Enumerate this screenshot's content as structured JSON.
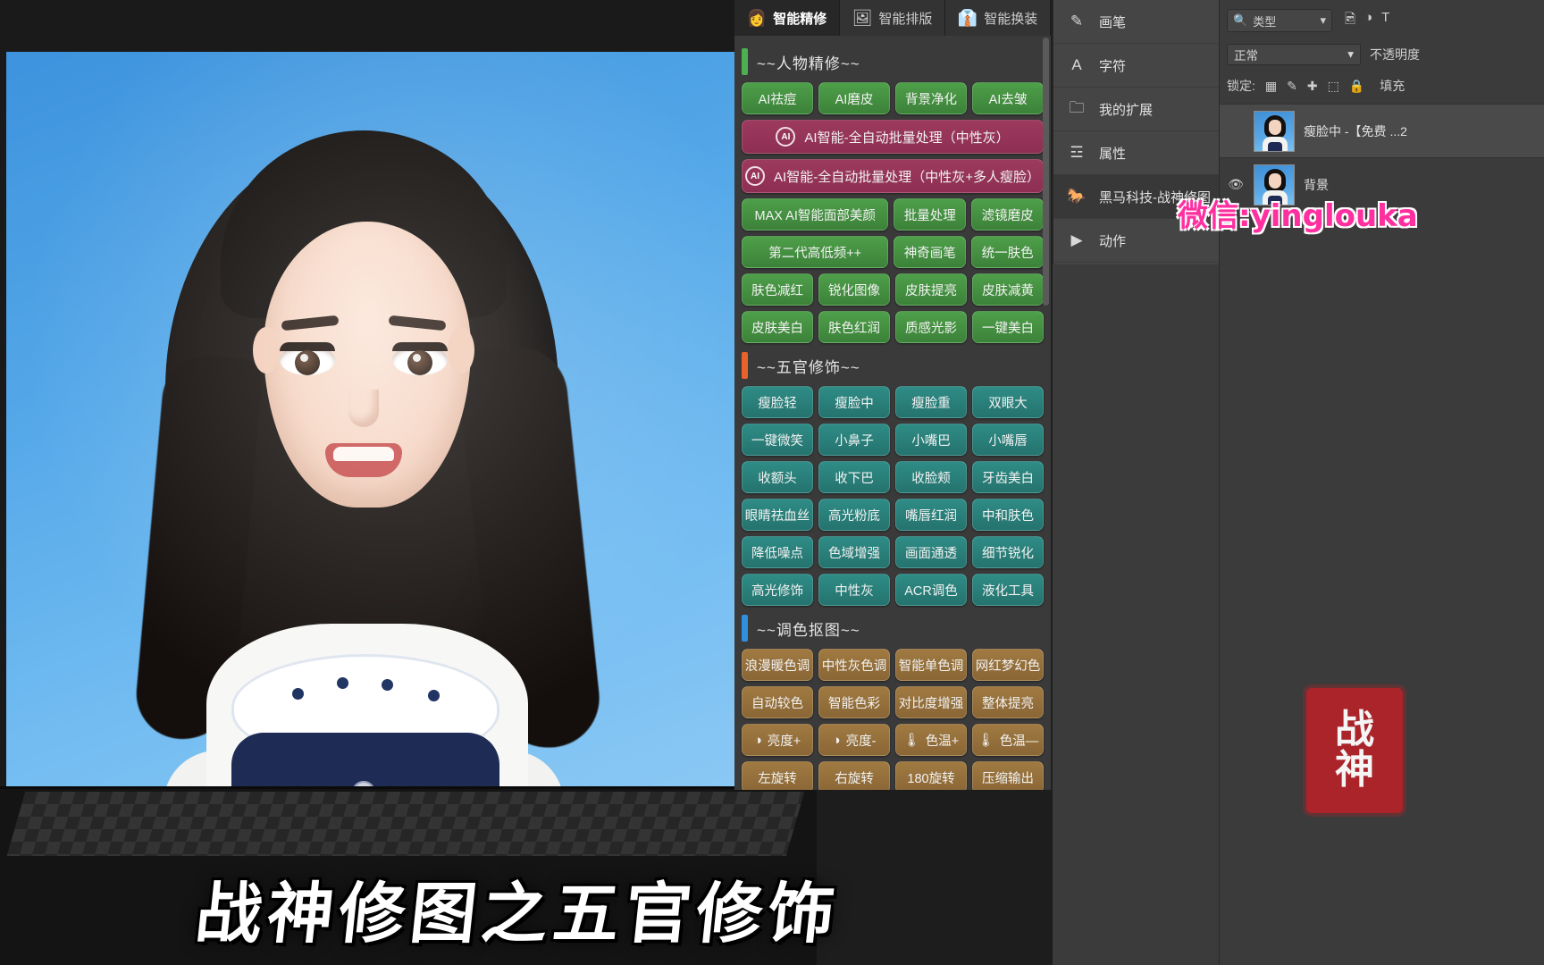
{
  "app": {
    "caption": "战神修图之五官修饰",
    "wechat_watermark": "微信:yinglouka",
    "stamp_line1": "战",
    "stamp_line2": "神"
  },
  "plugin": {
    "tabs": [
      {
        "label": "智能精修",
        "icon": "face-icon",
        "glyph": "👩",
        "active": true
      },
      {
        "label": "智能排版",
        "icon": "layout-icon",
        "glyph": "🖼",
        "active": false
      },
      {
        "label": "智能换装",
        "icon": "clothes-icon",
        "glyph": "👔",
        "active": false
      }
    ],
    "sections": [
      {
        "title": "~~人物精修~~",
        "bar_color": "#4caf50",
        "rows": [
          {
            "style": "green",
            "buttons": [
              {
                "label": "AI祛痘"
              },
              {
                "label": "AI磨皮"
              },
              {
                "label": "背景净化"
              },
              {
                "label": "AI去皱"
              }
            ]
          },
          {
            "style": "magenta",
            "buttons": [
              {
                "label": "AI智能-全自动批量处理（中性灰）",
                "icon": "ai-circle-icon",
                "full": true
              }
            ]
          },
          {
            "style": "magenta",
            "buttons": [
              {
                "label": "AI智能-全自动批量处理（中性灰+多人瘦脸）",
                "icon": "ai-circle-icon",
                "full": true
              }
            ]
          },
          {
            "style": "green",
            "buttons": [
              {
                "label": "MAX AI智能面部美颜",
                "wide": true
              },
              {
                "label": "批量处理"
              },
              {
                "label": "滤镜磨皮"
              }
            ]
          },
          {
            "style": "green",
            "buttons": [
              {
                "label": "第二代高低频++",
                "wide": true
              },
              {
                "label": "神奇画笔"
              },
              {
                "label": "统一肤色"
              }
            ]
          },
          {
            "style": "green",
            "buttons": [
              {
                "label": "肤色减红"
              },
              {
                "label": "锐化图像"
              },
              {
                "label": "皮肤提亮"
              },
              {
                "label": "皮肤减黄"
              }
            ]
          },
          {
            "style": "green",
            "buttons": [
              {
                "label": "皮肤美白"
              },
              {
                "label": "肤色红润"
              },
              {
                "label": "质感光影"
              },
              {
                "label": "一键美白"
              }
            ]
          }
        ]
      },
      {
        "title": "~~五官修饰~~",
        "bar_color": "#e8622a",
        "rows": [
          {
            "style": "teal",
            "buttons": [
              {
                "label": "瘦脸轻"
              },
              {
                "label": "瘦脸中"
              },
              {
                "label": "瘦脸重"
              },
              {
                "label": "双眼大"
              }
            ]
          },
          {
            "style": "teal",
            "buttons": [
              {
                "label": "一键微笑"
              },
              {
                "label": "小鼻子"
              },
              {
                "label": "小嘴巴"
              },
              {
                "label": "小嘴唇"
              }
            ]
          },
          {
            "style": "teal",
            "buttons": [
              {
                "label": "收额头"
              },
              {
                "label": "收下巴"
              },
              {
                "label": "收脸颊"
              },
              {
                "label": "牙齿美白"
              }
            ]
          },
          {
            "style": "teal",
            "buttons": [
              {
                "label": "眼睛祛血丝"
              },
              {
                "label": "高光粉底"
              },
              {
                "label": "嘴唇红润"
              },
              {
                "label": "中和肤色"
              }
            ]
          },
          {
            "style": "teal",
            "buttons": [
              {
                "label": "降低噪点"
              },
              {
                "label": "色域增强"
              },
              {
                "label": "画面通透"
              },
              {
                "label": "细节锐化"
              }
            ]
          },
          {
            "style": "teal",
            "buttons": [
              {
                "label": "高光修饰"
              },
              {
                "label": "中性灰"
              },
              {
                "label": "ACR调色"
              },
              {
                "label": "液化工具"
              }
            ]
          }
        ]
      },
      {
        "title": "~~调色抠图~~",
        "bar_color": "#2f8fe0",
        "rows": [
          {
            "style": "brown",
            "buttons": [
              {
                "label": "浪漫暖色调"
              },
              {
                "label": "中性灰色调"
              },
              {
                "label": "智能单色调"
              },
              {
                "label": "网红梦幻色"
              }
            ]
          },
          {
            "style": "brown",
            "buttons": [
              {
                "label": "自动较色"
              },
              {
                "label": "智能色彩"
              },
              {
                "label": "对比度增强"
              },
              {
                "label": "整体提亮"
              }
            ]
          },
          {
            "style": "brown",
            "buttons": [
              {
                "label": "亮度+",
                "icon": "contrast-icon"
              },
              {
                "label": "亮度-",
                "icon": "contrast-icon"
              },
              {
                "label": "色温+",
                "icon": "thermometer-icon"
              },
              {
                "label": "色温—",
                "icon": "thermometer-icon"
              }
            ]
          },
          {
            "style": "brown",
            "buttons": [
              {
                "label": "左旋转"
              },
              {
                "label": "右旋转"
              },
              {
                "label": "180旋转"
              },
              {
                "label": "压缩输出"
              }
            ]
          }
        ]
      }
    ]
  },
  "ps_rail": {
    "items": [
      {
        "label": "画笔",
        "icon": "brush-icon",
        "glyph": "✎",
        "active": false
      },
      {
        "label": "字符",
        "icon": "character-icon",
        "glyph": "A",
        "active": false
      },
      {
        "label": "我的扩展",
        "icon": "folder-icon",
        "glyph": "🗀",
        "active": false
      },
      {
        "label": "属性",
        "icon": "properties-icon",
        "glyph": "☲",
        "active": false
      },
      {
        "label": "黑马科技-战神修图",
        "icon": "horse-icon",
        "glyph": "🐎",
        "active": true
      },
      {
        "label": "动作",
        "icon": "play-icon",
        "glyph": "▶",
        "active": false
      }
    ]
  },
  "layers_panel": {
    "search_placeholder": "类型",
    "search_icon": "search-icon",
    "blend_mode": "正常",
    "opacity_label": "不透明度",
    "lock_label": "锁定:",
    "fill_label": "填充",
    "lock_icons": [
      "▦",
      "✎",
      "✚",
      "⬚",
      "🔒"
    ],
    "layers": [
      {
        "name": "瘦脸中 -【免费 ...2",
        "visible": false,
        "selected": true
      },
      {
        "name": "背景",
        "visible": true,
        "selected": false
      }
    ]
  }
}
